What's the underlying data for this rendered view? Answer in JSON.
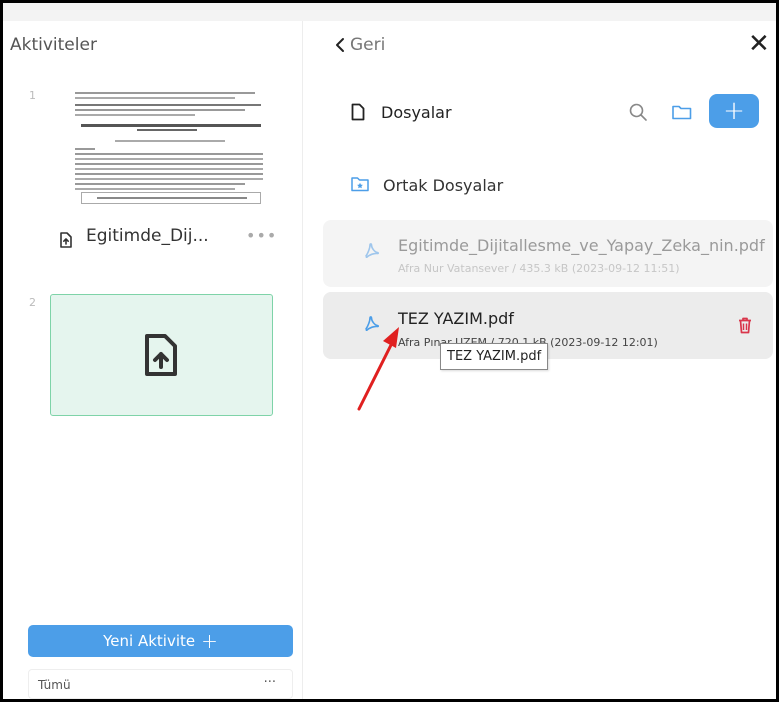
{
  "left_panel": {
    "title": "Aktiviteler",
    "activities": [
      {
        "number": "1",
        "label": "Egitimde_Dij...",
        "more": "•••"
      },
      {
        "number": "2",
        "label": ""
      }
    ],
    "new_activity_button": "Yeni Aktivite",
    "filter": {
      "value": "Tümü",
      "more": "···"
    }
  },
  "right_panel": {
    "back_label": "Geri",
    "close_label": "✕",
    "files_heading": "Dosyalar",
    "shared_label": "Ortak Dosyalar",
    "add_label": "+",
    "files": [
      {
        "name": "Egitimde_Dijitallesme_ve_Yapay_Zeka_nin.pdf",
        "meta": "Afra Nur Vatansever / 435.3 kB (2023-09-12 11:51)"
      },
      {
        "name": "TEZ YAZIM.pdf",
        "meta": "Afra Pınar UZEM / 720.1 kB (2023-09-12 12:01)"
      }
    ],
    "tooltip": "TEZ YAZIM.pdf"
  },
  "colors": {
    "accent": "#4c9ee8",
    "delete": "#d9364b",
    "selected_activity_bg": "#e5f5ee",
    "annotation_arrow": "#e02020"
  },
  "icons": [
    "file-upload-icon",
    "chevron-left-icon",
    "close-icon",
    "document-icon",
    "search-icon",
    "folder-icon",
    "shared-folder-icon",
    "pdf-icon",
    "trash-icon"
  ]
}
